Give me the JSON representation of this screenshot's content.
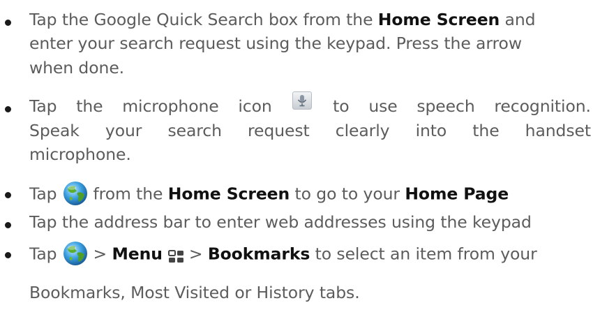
{
  "bullets": [
    {
      "lines": [
        {
          "parts": [
            "Tap the Google Quick Search box from the ",
            "Home Screen",
            " and"
          ]
        },
        {
          "text": "enter your search request using the keypad. Press the arrow"
        },
        {
          "text": "when done."
        }
      ]
    },
    {
      "lines": [
        {
          "words": [
            "Tap",
            "the",
            "microphone",
            "icon",
            "to",
            "use",
            "speech",
            "recognition."
          ]
        },
        {
          "words": [
            "Speak",
            "your",
            "search",
            "request",
            "clearly",
            "into",
            "the",
            "handset"
          ]
        },
        {
          "text": "microphone."
        }
      ]
    },
    {
      "parts": [
        "Tap",
        "from the ",
        "Home Screen",
        " to go to your ",
        "Home Page"
      ]
    },
    {
      "text": "Tap the address bar to enter web addresses using the keypad"
    },
    {
      "parts": [
        "Tap",
        "> ",
        "Menu",
        "> ",
        "Bookmarks",
        " to select an item from your"
      ],
      "continuation": "Bookmarks, Most Visited or History tabs."
    }
  ],
  "icons": {
    "microphone": "microphone-icon",
    "browser": "globe-icon",
    "menu": "menu-grid-icon"
  }
}
